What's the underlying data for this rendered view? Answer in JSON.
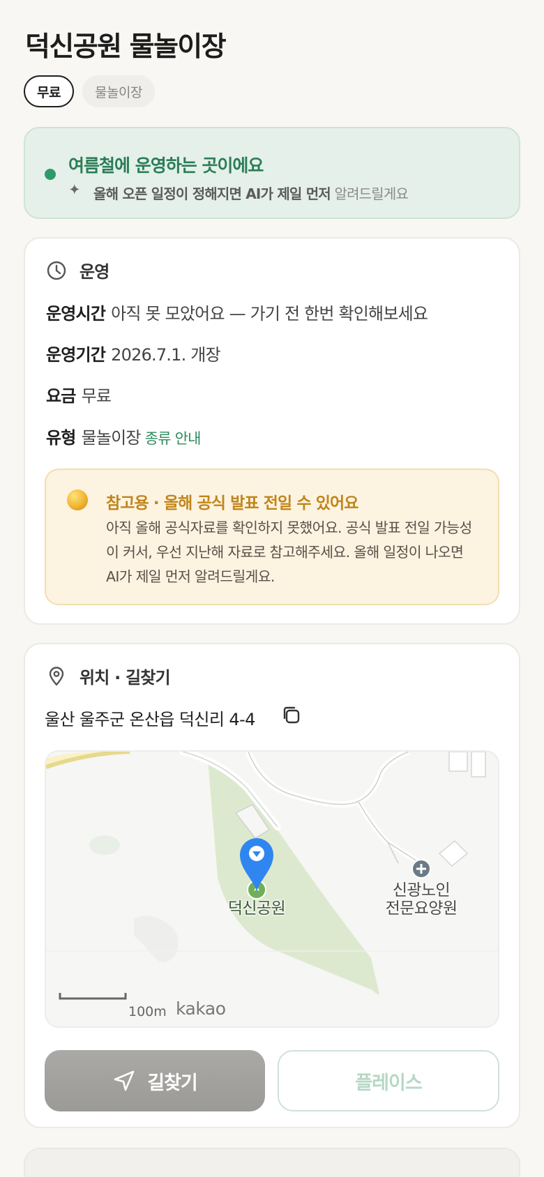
{
  "header": {
    "title": "덕신공원 물놀이장",
    "chips": {
      "price": "무료",
      "category": "물놀이장"
    }
  },
  "notice": {
    "title": "여름철에 운영하는 곳이에요",
    "sparkle_icon": "sparkle-icon",
    "subtitle_bold": "올해 오픈 일정이 정해지면 AI가 제일 먼저",
    "subtitle_light": "알려드릴게요"
  },
  "operation": {
    "heading": "운영",
    "icon": "clock-icon",
    "hours_label": "운영시간",
    "hours_value": "아직 못 모았어요 — 가기 전 한번 확인해보세요",
    "period_label": "운영기간",
    "period_value": "2026.7.1. 개장",
    "fee_label": "요금",
    "fee_value": "무료",
    "type_label": "유형",
    "type_value": "물놀이장",
    "type_link": "종류 안내",
    "warning": {
      "title": "참고용 · 올해 공식 발표 전일 수 있어요",
      "body": "아직 올해 공식자료를 확인하지 못했어요. 공식 발표 전일 가능성이 커서, 우선 지난해 자료로 참고해주세요. 올해 일정이 나오면 AI가 제일 먼저 알려드릴게요."
    }
  },
  "location": {
    "heading": "위치 · 길찾기",
    "icon": "location-pin-icon",
    "address": "울산 울주군 온산읍 덕신리 4-4",
    "copy_icon": "copy-icon",
    "map": {
      "park_label": "덕신공원",
      "facility_label_line1": "신광노인",
      "facility_label_line2": "전문요양원",
      "scale_label": "100m",
      "provider": "kakao"
    },
    "route_button": "길찾기",
    "place_button": "플레이스"
  },
  "colors": {
    "accent_green": "#2e9a68",
    "warning_gold": "#c0851a",
    "pin_blue": "#2f86f0"
  }
}
